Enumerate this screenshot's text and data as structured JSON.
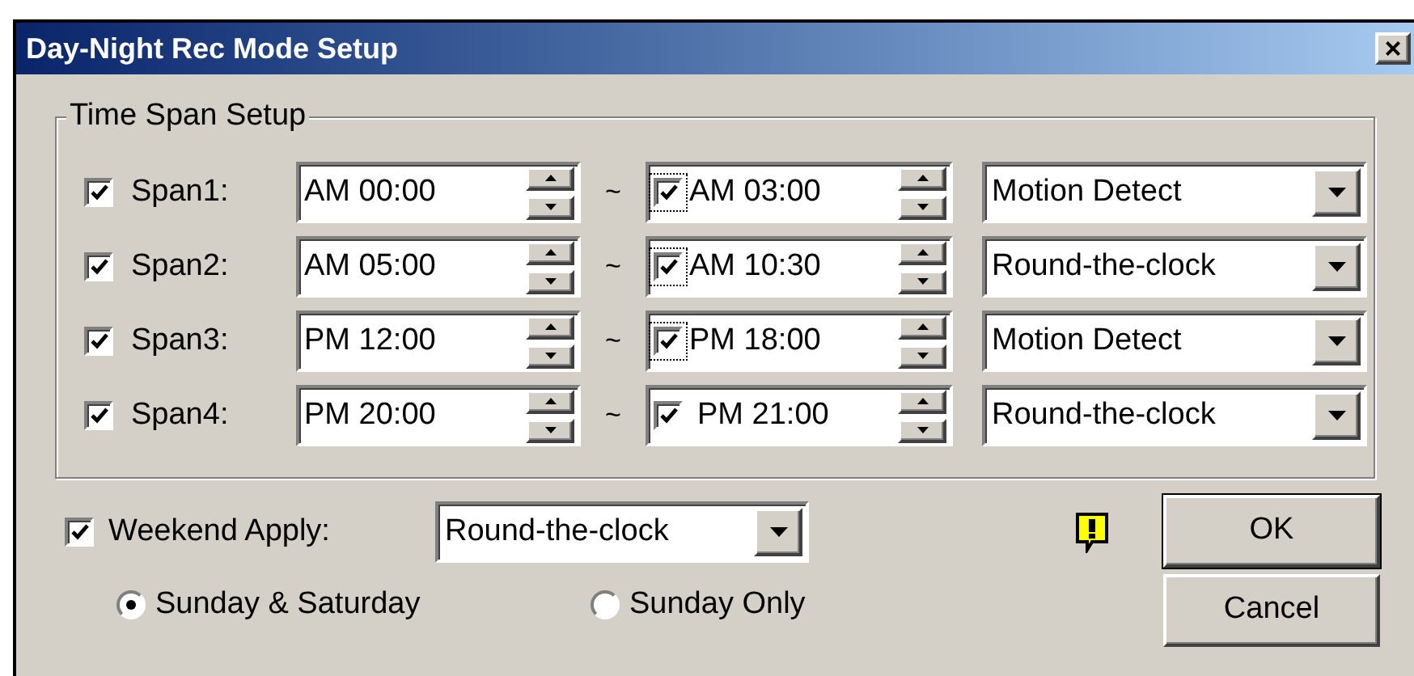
{
  "window": {
    "title": "Day-Night Rec Mode Setup",
    "close": "×"
  },
  "group": {
    "title": "Time Span Setup"
  },
  "spans": [
    {
      "checked": true,
      "label": "Span1:",
      "start": "AM 00:00",
      "tilde": "~",
      "end_checked": true,
      "end_focused": true,
      "end": "AM 03:00",
      "mode": "Motion Detect"
    },
    {
      "checked": true,
      "label": "Span2:",
      "start": "AM 05:00",
      "tilde": "~",
      "end_checked": true,
      "end_focused": true,
      "end": "AM 10:30",
      "mode": "Round-the-clock"
    },
    {
      "checked": true,
      "label": "Span3:",
      "start": "PM 12:00",
      "tilde": "~",
      "end_checked": true,
      "end_focused": true,
      "end": "PM 18:00",
      "mode": "Motion Detect"
    },
    {
      "checked": true,
      "label": "Span4:",
      "start": "PM 20:00",
      "tilde": "~",
      "end_checked": true,
      "end_focused": false,
      "end": "PM 21:00",
      "mode": "Round-the-clock"
    }
  ],
  "weekend": {
    "checked": true,
    "label": "Weekend Apply:",
    "mode": "Round-the-clock"
  },
  "weekend_days": [
    {
      "label": "Sunday & Saturday",
      "selected": true
    },
    {
      "label": "Sunday Only",
      "selected": false
    }
  ],
  "buttons": [
    "OK",
    "Cancel"
  ]
}
